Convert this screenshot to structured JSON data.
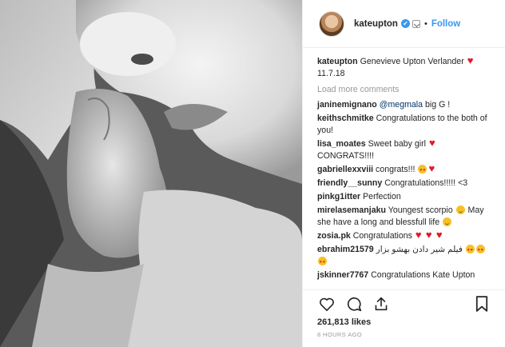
{
  "post": {
    "username": "kateupton",
    "follow_label": "Follow",
    "separator": "•",
    "verified_glyph": "✔",
    "caption": {
      "username": "kateupton",
      "text": "Genevieve Upton Verlander",
      "date": "11.7.18"
    },
    "load_more": "Load more comments",
    "comments": [
      {
        "user": "janinemignano",
        "mention": "@megmala",
        "text": " big G !"
      },
      {
        "user": "keithschmitke",
        "text": "Congratulations to the both of you!"
      },
      {
        "user": "lisa_moates",
        "text": "Sweet baby girl",
        "text2": "CONGRATS!!!!"
      },
      {
        "user": "gabriellexxviii",
        "text": "congrats!!!"
      },
      {
        "user": "friendly__sunny",
        "text": "Congratulations!!!!! <3"
      },
      {
        "user": "pinkg1itter",
        "text": "Perfection"
      },
      {
        "user": "mirelasemanjaku",
        "text": "Youngest scorpio",
        "text2": "May she have a long and blessfull life"
      },
      {
        "user": "zosia.pk",
        "text": "Congratulations"
      },
      {
        "user": "ebrahim21579",
        "text": "فیلم شیر دادن بهشو بزار"
      },
      {
        "user": "jskinner7767",
        "text": "Congratulations Kate Upton"
      }
    ],
    "likes": "261,813 likes",
    "time": "8 HOURS AGO",
    "icons": [
      "heart-icon",
      "comment-icon",
      "share-icon",
      "bookmark-icon"
    ],
    "colors": {
      "accent": "#3897f0",
      "heart": "#e0192c",
      "muted": "#999999"
    }
  }
}
